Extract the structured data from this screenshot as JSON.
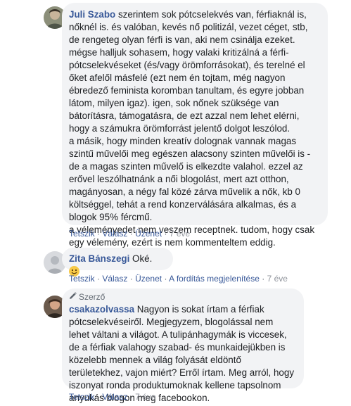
{
  "comments": [
    {
      "author": "Juli Szabo",
      "text": " szerintem sok pótcselekvés van, férfiaknál is, nőknél is. és valóban, kevés nő politizál, vezet céget, stb, de rengeteg olyan férfi is van, aki nem csinálja ezeket. mégse halljuk sohasem, hogy valaki kritizálná a férfi-pótcselekvéseket (és/vagy örömforrásokat), és terelné el őket afelől másfelé (ezt nem én tojtam, még nagyon ébredező feminista koromban tanultam, és egyre jobban látom, milyen igaz). igen, sok nőnek szüksége van bátorításra, támogatásra, de ezt azzal nem lehet elérni, hogy a számukra örömforrást jelentő dolgot leszólod.\na másik, hogy minden kreatív dolognak vannak magas szintű művelői meg egészen alacsony szinten művelői is - de a magas szinten művelő is elkezdte valahol. ezzel az erővel leszólhatnánk a női blogolást, mert azt otthon, magányosan, a négy fal közé zárva művelik a nők, kb 0 költséggel, tehát a rend konzerválására alkalmas, és a blogok 95% fércmű.\na véleményedet nem veszem receptnek. tudom, hogy csak egy vélemény, ezért is nem kommenteltem eddig.",
      "actions": {
        "like": "Tetszik",
        "reply": "Válasz",
        "message": "Üzenet",
        "time": "7 éve"
      }
    },
    {
      "author": "Zita Bánszegi",
      "text": " Oké.",
      "emoji_icon": "smile-emoji",
      "actions": {
        "like": "Tetszik",
        "reply": "Válasz",
        "message": "Üzenet",
        "translation": "A fordítás megjelenítése",
        "time": "7 éve"
      }
    },
    {
      "badge": "Szerző",
      "badge_icon": "pencil-icon",
      "author": "csakazolvassa",
      "text": " Nagyon is sokat írtam a férfiak pótcselekvéseiről. Megjegyzem, blogolással nem lehet váltani a világot. A tulipánhagymák is viccesek, de a férfiak valahogy szabad- és munkaidejükben is közelebb mennek a világ folyását eldöntő területekhez, vajon miért? Erről írtam. Meg arról, hogy iszonyat ronda produktumoknak kellene tapsolnom anyukás blogon meg facebookon.",
      "actions": {
        "like": "Tetszik",
        "reply": "Válasz",
        "time": "7 éve"
      }
    }
  ],
  "colors": {
    "link": "#385898",
    "bubble": "#f2f3f5",
    "meta": "#606770"
  }
}
